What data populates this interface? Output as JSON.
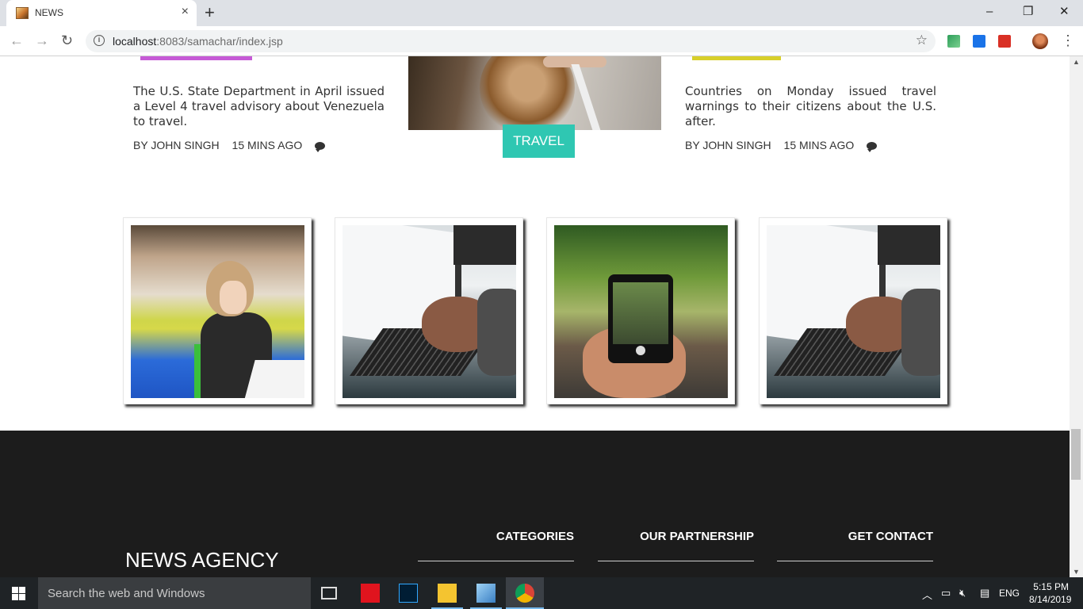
{
  "browser": {
    "tab_title": "NEWS",
    "tab_close": "×",
    "new_tab": "+",
    "window_controls": {
      "minimize": "–",
      "restore": "❐",
      "close": "✕"
    },
    "nav": {
      "back": "←",
      "forward": "→",
      "reload": "↻"
    },
    "url_host": "localhost",
    "url_rest": ":8083/samachar/index.jsp",
    "star": "☆",
    "menu": "⋮"
  },
  "articles": [
    {
      "text": "The U.S. State Department in April issued a Level 4 travel advisory about Venezuela to travel.",
      "author": "BY JOHN SINGH",
      "time": "15 MINS AGO",
      "accent": "#c65ad6"
    },
    {
      "text": "Countries on Monday issued travel warnings to their citizens about the U.S. after.",
      "author": "BY JOHN SINGH",
      "time": "15 MINS AGO",
      "accent": "#d8cf2a"
    }
  ],
  "featured_badge": "TRAVEL",
  "gallery": [
    "child-drawing-photo",
    "laptop-typing-photo",
    "phone-camera-forest-photo",
    "laptop-typing-photo"
  ],
  "footer": {
    "brand": "NEWS AGENCY",
    "columns": [
      "CATEGORIES",
      "OUR PARTNERSHIP",
      "GET CONTACT"
    ]
  },
  "taskbar": {
    "search_placeholder": "Search the web and Windows",
    "language": "ENG",
    "time": "5:15 PM",
    "date": "8/14/2019"
  },
  "colors": {
    "travel_badge": "#2fc7b2",
    "footer_bg": "#1c1c1c",
    "taskbar_bg": "#1f2326"
  }
}
